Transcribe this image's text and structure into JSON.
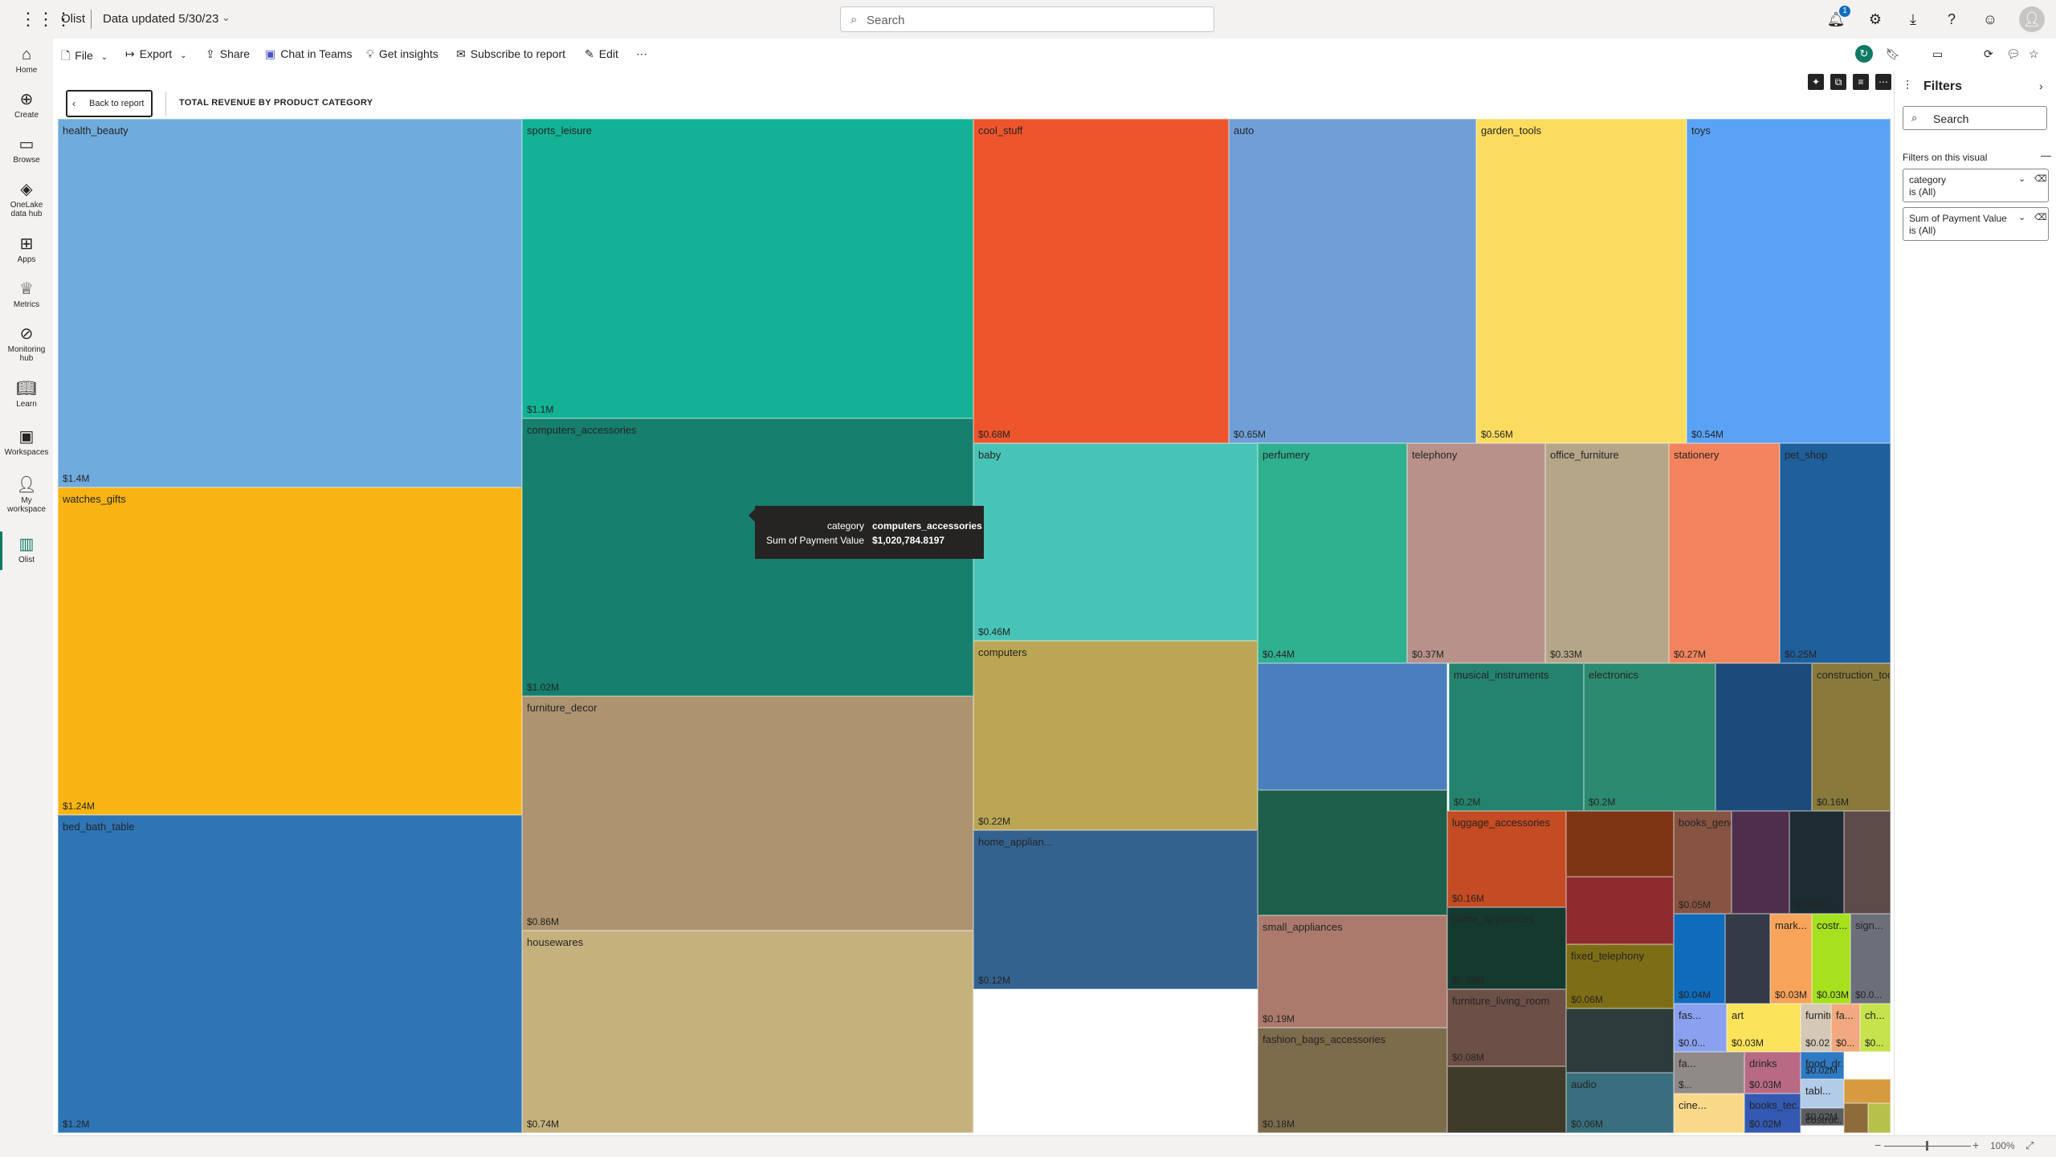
{
  "app": {
    "name": "Olist",
    "data_updated": "Data updated 5/30/23",
    "search_placeholder": "Search",
    "notification_count": "1"
  },
  "left_nav": [
    {
      "label": "Home",
      "icon": "home-icon"
    },
    {
      "label": "Create",
      "icon": "plus-circle-icon"
    },
    {
      "label": "Browse",
      "icon": "folder-icon"
    },
    {
      "label": "OneLake data hub",
      "icon": "onelake-icon"
    },
    {
      "label": "Apps",
      "icon": "apps-icon"
    },
    {
      "label": "Metrics",
      "icon": "trophy-icon"
    },
    {
      "label": "Monitoring hub",
      "icon": "monitor-icon"
    },
    {
      "label": "Learn",
      "icon": "book-icon"
    },
    {
      "label": "Workspaces",
      "icon": "workspaces-icon"
    },
    {
      "label": "My workspace",
      "icon": "person-icon"
    },
    {
      "label": "Olist",
      "icon": "report-icon"
    }
  ],
  "toolbar": {
    "file": "File",
    "export": "Export",
    "share": "Share",
    "chat": "Chat in Teams",
    "insights": "Get insights",
    "subscribe": "Subscribe to report",
    "edit": "Edit",
    "more": "⋯"
  },
  "visual": {
    "back_label": "Back to report",
    "title": "TOTAL REVENUE BY PRODUCT CATEGORY"
  },
  "tooltip": {
    "category_key": "category",
    "category_value": "computers_accessories",
    "value_key": "Sum of Payment Value",
    "value_value": "$1,020,784.8197"
  },
  "filters": {
    "title": "Filters",
    "search_placeholder": "Search",
    "section": "Filters on this visual",
    "cards": [
      {
        "line1": "category",
        "line2": "is (All)"
      },
      {
        "line1": "Sum of Payment Value",
        "line2": "is (All)"
      }
    ]
  },
  "status": {
    "zoom": "100%"
  },
  "chart_data": {
    "type": "treemap",
    "title": "TOTAL REVENUE BY PRODUCT CATEGORY",
    "measure": "Sum of Payment Value",
    "tiles": [
      {
        "name": "health_beauty",
        "label": "$1.4M",
        "value": 1.4,
        "color": "#6fabdd"
      },
      {
        "name": "watches_gifts",
        "label": "$1.24M",
        "value": 1.24,
        "color": "#f8b413"
      },
      {
        "name": "bed_bath_table",
        "label": "$1.2M",
        "value": 1.2,
        "color": "#2e75b6"
      },
      {
        "name": "sports_leisure",
        "label": "$1.1M",
        "value": 1.1,
        "color": "#12b294"
      },
      {
        "name": "computers_accessories",
        "label": "$1.02M",
        "value": 1.02,
        "color": "#167f6d"
      },
      {
        "name": "furniture_decor",
        "label": "$0.86M",
        "value": 0.86,
        "color": "#ae9370"
      },
      {
        "name": "housewares",
        "label": "$0.74M",
        "value": 0.74,
        "color": "#c5b17c"
      },
      {
        "name": "cool_stuff",
        "label": "$0.68M",
        "value": 0.68,
        "color": "#ee552c"
      },
      {
        "name": "auto",
        "label": "$0.65M",
        "value": 0.65,
        "color": "#709fd8"
      },
      {
        "name": "garden_tools",
        "label": "$0.56M",
        "value": 0.56,
        "color": "#fbdc5e"
      },
      {
        "name": "toys",
        "label": "$0.54M",
        "value": 0.54,
        "color": "#59a2f5"
      },
      {
        "name": "baby",
        "label": "$0.46M",
        "value": 0.46,
        "color": "#48c3b8"
      },
      {
        "name": "perfumery",
        "label": "$0.44M",
        "value": 0.44,
        "color": "#2fb08f"
      },
      {
        "name": "telephony",
        "label": "$0.37M",
        "value": 0.37,
        "color": "#b8928a"
      },
      {
        "name": "office_furniture",
        "label": "$0.33M",
        "value": 0.33,
        "color": "#b5a688"
      },
      {
        "name": "stationery",
        "label": "$0.27M",
        "value": 0.27,
        "color": "#f2845d"
      },
      {
        "name": "pet_shop",
        "label": "$0.25M",
        "value": 0.25,
        "color": "#1f5f9c"
      },
      {
        "name": "computers",
        "label": "$0.22M",
        "value": 0.22,
        "color": "#baa654"
      },
      {
        "name": "",
        "label": "",
        "value": 0.21,
        "color": "#4a7fbe"
      },
      {
        "name": "musical_instruments",
        "label": "$0.2M",
        "value": 0.2,
        "color": "#24836e"
      },
      {
        "name": "electronics",
        "label": "$0.2M",
        "value": 0.2,
        "color": "#2c8a6f"
      },
      {
        "name": "",
        "label": "",
        "value": 0.19,
        "color": "#1c4b79"
      },
      {
        "name": "construction_tools_con...",
        "label": "$0.16M",
        "value": 0.16,
        "color": "#887a3b"
      },
      {
        "name": "home_applian...",
        "label": "$0.12M",
        "value": 0.12,
        "color": "#34628f"
      },
      {
        "name": "",
        "label": "",
        "value": 0.11,
        "color": "#1e5f4b"
      },
      {
        "name": "small_appliances",
        "label": "$0.19M",
        "value": 0.19,
        "color": "#ab7a6c"
      },
      {
        "name": "fashion_bags_accessories",
        "label": "$0.18M",
        "value": 0.18,
        "color": "#7c6c4b"
      },
      {
        "name": "luggage_accessories",
        "label": "$0.16M",
        "value": 0.16,
        "color": "#c44b22"
      },
      {
        "name": "home_appliances",
        "label": "$0.09M",
        "value": 0.09,
        "color": "#143a2f"
      },
      {
        "name": "furniture_living_room",
        "label": "$0.08M",
        "value": 0.08,
        "color": "#6c4f47"
      },
      {
        "name": "",
        "label": "",
        "value": 0.07,
        "color": "#3f3b2b"
      },
      {
        "name": "",
        "label": "",
        "value": 0.06,
        "color": "#7e3514"
      },
      {
        "name": "",
        "label": "",
        "value": 0.07,
        "color": "#8f2a2f"
      },
      {
        "name": "fixed_telephony",
        "label": "$0.06M",
        "value": 0.06,
        "color": "#7e6d17"
      },
      {
        "name": "",
        "label": "",
        "value": 0.05,
        "color": "#2d3b3a"
      },
      {
        "name": "audio",
        "label": "$0.06M",
        "value": 0.06,
        "color": "#386e7d"
      },
      {
        "name": "books_general_int...",
        "label": "$0.05M",
        "value": 0.05,
        "color": "#865441"
      },
      {
        "name": "",
        "label": "",
        "value": 0.05,
        "color": "#4d2f4d"
      },
      {
        "name": "",
        "label": "$0.05M",
        "value": 0.05,
        "color": "#1d2b33"
      },
      {
        "name": "",
        "label": "",
        "value": 0.04,
        "color": "#5d4b48"
      },
      {
        "name": "",
        "label": "$0.04M",
        "value": 0.04,
        "color": "#0f6cbd"
      },
      {
        "name": "",
        "label": "",
        "value": 0.03,
        "color": "#333b47"
      },
      {
        "name": "mark...",
        "label": "$0.03M",
        "value": 0.03,
        "color": "#f6a45a"
      },
      {
        "name": "costr...",
        "label": "$0.03M",
        "value": 0.03,
        "color": "#a6e11d"
      },
      {
        "name": "sign...",
        "label": "$0.0...",
        "value": 0.03,
        "color": "#6b6f7a"
      },
      {
        "name": "fas...",
        "label": "$0.0...",
        "value": 0.03,
        "color": "#8aa1f0"
      },
      {
        "name": "art",
        "label": "$0.03M",
        "value": 0.03,
        "color": "#fbe35a"
      },
      {
        "name": "furnitur...",
        "label": "$0.02M",
        "value": 0.02,
        "color": "#d4c8b6"
      },
      {
        "name": "fa...",
        "label": "$0...",
        "value": 0.02,
        "color": "#f3a97f"
      },
      {
        "name": "ch...",
        "label": "$0...",
        "value": 0.02,
        "color": "#c5e34c"
      },
      {
        "name": "fa...",
        "label": "$...",
        "value": 0.02,
        "color": "#8f8a87"
      },
      {
        "name": "drinks",
        "label": "$0.03M",
        "value": 0.03,
        "color": "#b86a85"
      },
      {
        "name": "food_dr...",
        "label": "$0.02M",
        "value": 0.02,
        "color": "#2e7bc4"
      },
      {
        "name": "tabl...",
        "label": "",
        "value": 0.02,
        "color": "#b1cbe8"
      },
      {
        "name": "cine...",
        "label": "",
        "value": 0.02,
        "color": "#f8d98a"
      },
      {
        "name": "books_tec...",
        "label": "$0.02M",
        "value": 0.02,
        "color": "#3359b2"
      },
      {
        "name": "costruc...",
        "label": "$0.02M",
        "value": 0.02,
        "color": "#5c5c61"
      },
      {
        "name": "music",
        "label": "",
        "value": 0.01,
        "color": "#b79fd8"
      }
    ]
  }
}
